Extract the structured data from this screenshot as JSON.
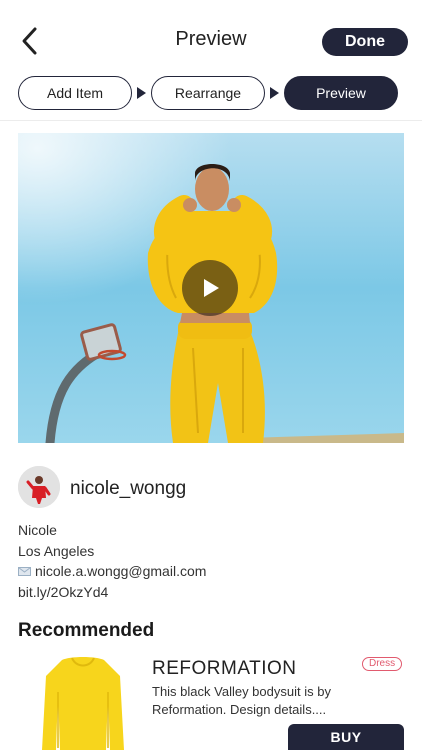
{
  "header": {
    "title": "Preview",
    "done_label": "Done",
    "back_icon": "chevron-left-icon"
  },
  "steps": [
    {
      "label": "Add Item",
      "active": false
    },
    {
      "label": "Rearrange",
      "active": false
    },
    {
      "label": "Preview",
      "active": true
    }
  ],
  "media": {
    "play_icon": "play-icon"
  },
  "profile": {
    "username": "nicole_wongg",
    "name": "Nicole",
    "location": "Los Angeles",
    "email": "nicole.a.wongg@gmail.com",
    "email_icon": "envelope-icon",
    "link": "bit.ly/2OkzYd4"
  },
  "recommended": {
    "title": "Recommended",
    "items": [
      {
        "brand": "REFORMATION",
        "category": "Dress",
        "description": "This black Valley bodysuit is by Reformation. Design details....",
        "buy_label": "BUY"
      }
    ]
  },
  "colors": {
    "primary": "#22253a",
    "tag": "#e15a6e",
    "outfit_yellow": "#f2c316",
    "sky": "#7cc8e6"
  }
}
